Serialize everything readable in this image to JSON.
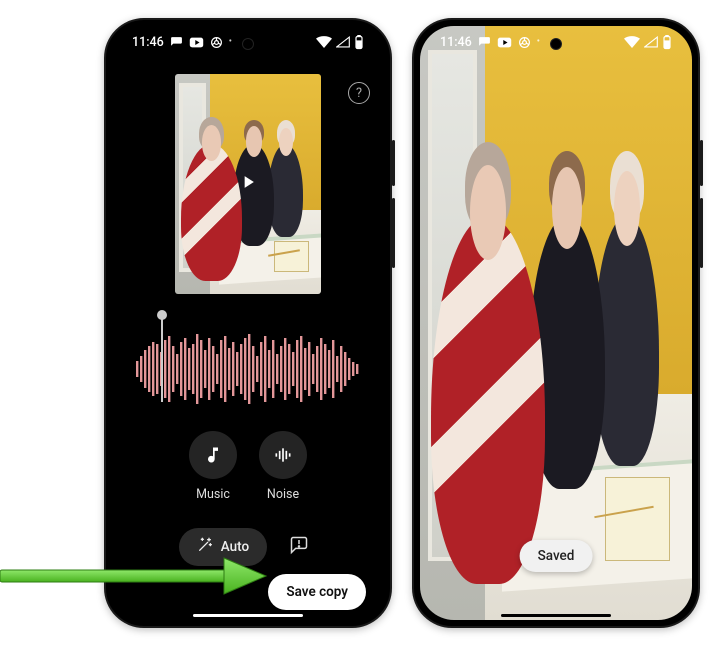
{
  "status": {
    "time": "11:46",
    "left_indicator_icons": [
      "chat-bubble-icon",
      "youtube-icon",
      "chrome-icon",
      "dot-icon"
    ],
    "right_indicator_icons": [
      "wifi-icon",
      "signal-icon",
      "battery-icon"
    ]
  },
  "left_phone": {
    "help_tooltip": "?",
    "video": {
      "play_icon": "play-icon"
    },
    "waveform": {
      "scrubber_position_pct": 11,
      "color": "#e39799"
    },
    "audio_tracks": [
      {
        "id": "music",
        "label": "Music",
        "icon": "music-note-icon"
      },
      {
        "id": "noise",
        "label": "Noise",
        "icon": "soundwave-icon"
      }
    ],
    "auto_button": {
      "label": "Auto",
      "icon": "wand-icon"
    },
    "feedback_button_icon": "feedback-icon",
    "save_button_label": "Save copy"
  },
  "right_phone": {
    "toast_label": "Saved"
  },
  "callout": {
    "target": "save-copy-button",
    "color": "#6fd44a"
  }
}
